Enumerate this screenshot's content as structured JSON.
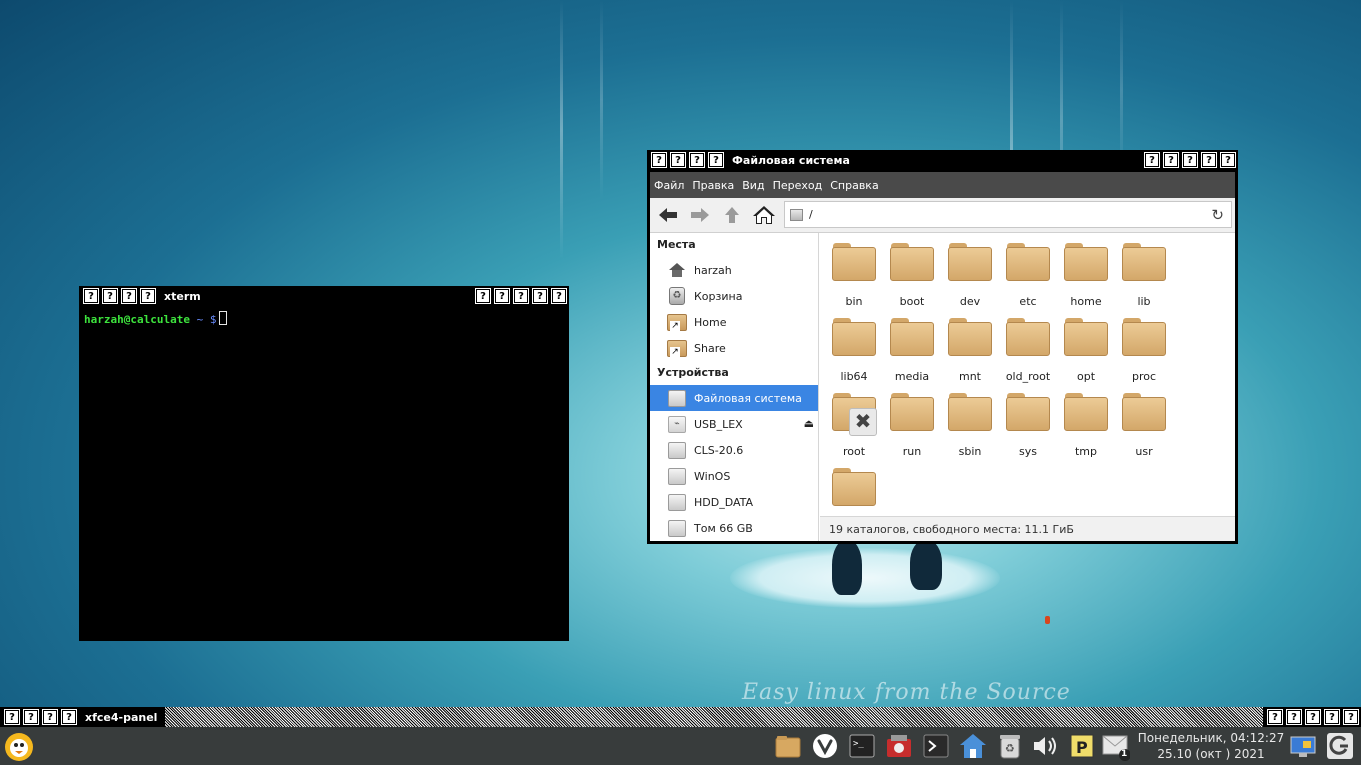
{
  "desktop": {
    "slogan": "Easy linux from the Source"
  },
  "xterm": {
    "title_buttons": [
      "?",
      "?",
      "?",
      "?"
    ],
    "title": "xterm",
    "right_buttons": [
      "?",
      "?",
      "?",
      "?",
      "?"
    ],
    "prompt_user": "harzah@calculate",
    "prompt_tilde": "~",
    "prompt_symbol": "$"
  },
  "file_manager": {
    "title_buttons": [
      "?",
      "?",
      "?",
      "?"
    ],
    "title": "Файловая система",
    "right_buttons": [
      "?",
      "?",
      "?",
      "?",
      "?"
    ],
    "menu": [
      "Файл",
      "Правка",
      "Вид",
      "Переход",
      "Справка"
    ],
    "path": "/",
    "sidebar": {
      "places_heading": "Места",
      "places": [
        "harzah",
        "Корзина",
        "Home",
        "Share"
      ],
      "devices_heading": "Устройства",
      "devices": [
        "Файловая система",
        "USB_LEX",
        "CLS-20.6",
        "WinOS",
        "HDD_DATA",
        "Том 66 GB"
      ],
      "selected": "Файловая система"
    },
    "folders": [
      "bin",
      "boot",
      "dev",
      "etc",
      "home",
      "lib",
      "lib64",
      "media",
      "mnt",
      "old_root",
      "opt",
      "proc",
      "root",
      "run",
      "sbin",
      "sys",
      "tmp",
      "usr",
      ""
    ],
    "status": "19 каталогов, свободного места: 11.1 ГиБ"
  },
  "panel": {
    "title_buttons": [
      "?",
      "?",
      "?",
      "?"
    ],
    "title": "xfce4-panel",
    "right_buttons": [
      "?",
      "?",
      "?",
      "?",
      "?"
    ],
    "clock_line1": "Понедельник, 04:12:27",
    "clock_line2": "25.10 (окт ) 2021",
    "mail_count": "1",
    "tray_icons": [
      "file-manager-icon",
      "vivaldi-icon",
      "terminal-icon",
      "screenshot-icon",
      "terminal-icon",
      "home-folder-icon",
      "trash-icon",
      "volume-icon",
      "parcellite-icon",
      "mail-icon"
    ]
  }
}
